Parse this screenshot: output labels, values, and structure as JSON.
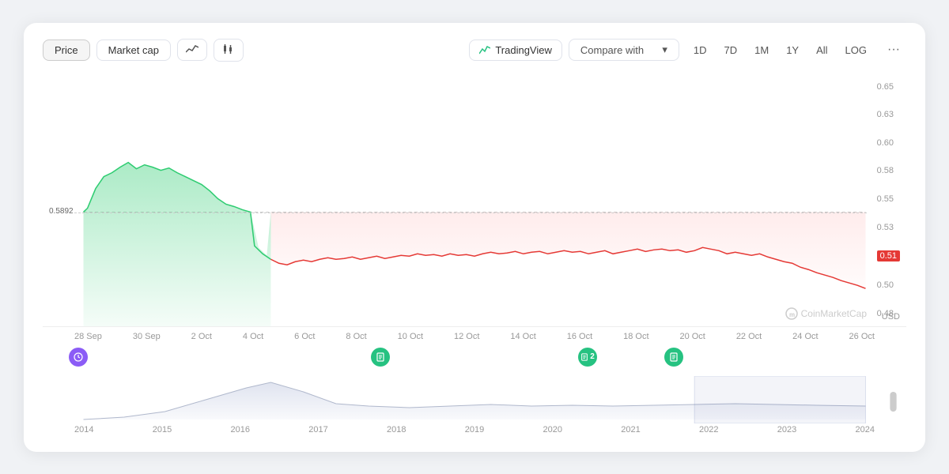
{
  "toolbar": {
    "price_label": "Price",
    "marketcap_label": "Market cap",
    "tradingview_label": "TradingView",
    "compare_label": "Compare with",
    "time_buttons": [
      "1D",
      "7D",
      "1M",
      "1Y",
      "All",
      "LOG"
    ],
    "more_icon": "···"
  },
  "chart": {
    "current_price": "0.51",
    "reference_price": "0.5892",
    "y_labels": [
      "0.65",
      "0.63",
      "0.60",
      "0.58",
      "0.55",
      "0.53",
      "0.51",
      "0.50",
      "0.48"
    ],
    "x_labels": [
      "28 Sep",
      "30 Sep",
      "2 Oct",
      "4 Oct",
      "6 Oct",
      "8 Oct",
      "10 Oct",
      "12 Oct",
      "14 Oct",
      "16 Oct",
      "18 Oct",
      "20 Oct",
      "22 Oct",
      "24 Oct",
      "26 Oct"
    ],
    "usd_label": "USD",
    "watermark": "CoinMarketCap"
  },
  "mini_chart": {
    "year_labels": [
      "2014",
      "2015",
      "2016",
      "2017",
      "2018",
      "2019",
      "2020",
      "2021",
      "2022",
      "2023",
      "2024"
    ]
  },
  "events": [
    {
      "type": "history",
      "left": "3%"
    },
    {
      "type": "doc",
      "left": "38%"
    },
    {
      "type": "doc2",
      "left": "63%"
    },
    {
      "type": "doc3",
      "left": "73%"
    }
  ]
}
